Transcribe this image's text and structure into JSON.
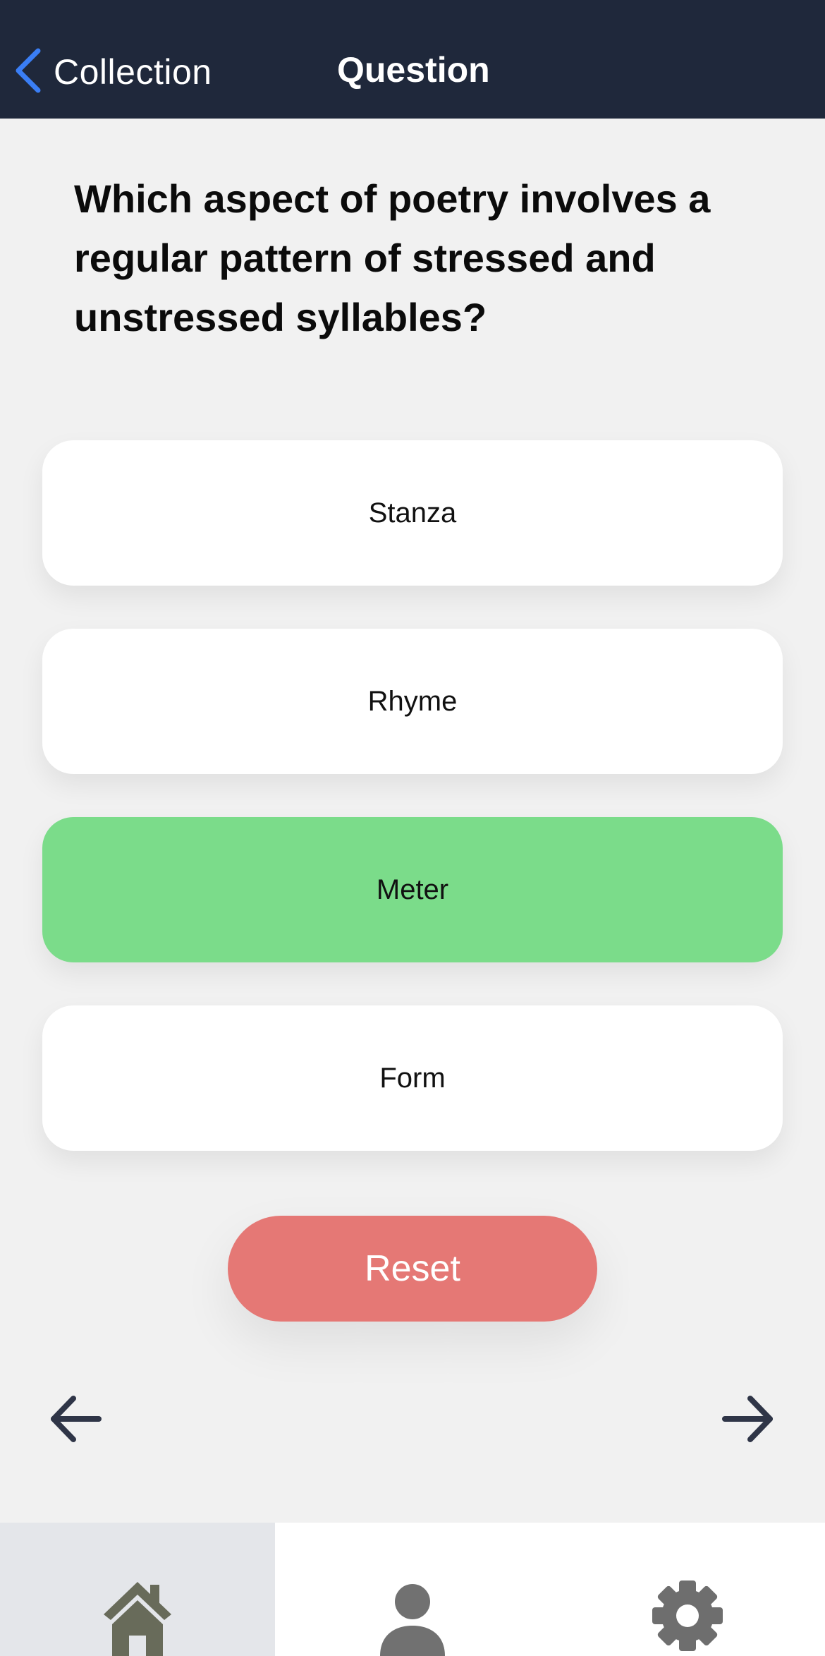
{
  "nav": {
    "back_label": "Collection",
    "title": "Question"
  },
  "question": {
    "text": "Which aspect of poetry involves a regular pattern of stressed and unstressed syllables?"
  },
  "options": [
    {
      "label": "Stanza",
      "state": "default"
    },
    {
      "label": "Rhyme",
      "state": "default"
    },
    {
      "label": "Meter",
      "state": "correct"
    },
    {
      "label": "Form",
      "state": "default"
    }
  ],
  "actions": {
    "reset_label": "Reset"
  },
  "navigation": {
    "prev_icon": "arrow-left-icon",
    "next_icon": "arrow-right-icon"
  },
  "tabs": [
    {
      "icon": "home-icon",
      "active": true
    },
    {
      "icon": "person-icon",
      "active": false
    },
    {
      "icon": "gear-icon",
      "active": false
    }
  ],
  "colors": {
    "navbar_bg": "#1f283b",
    "back_chevron": "#3a7ef5",
    "correct_option": "#7bdc8a",
    "reset_button": "#e57875",
    "arrow": "#2f3547",
    "active_tab_bg": "#e4e6ea"
  }
}
